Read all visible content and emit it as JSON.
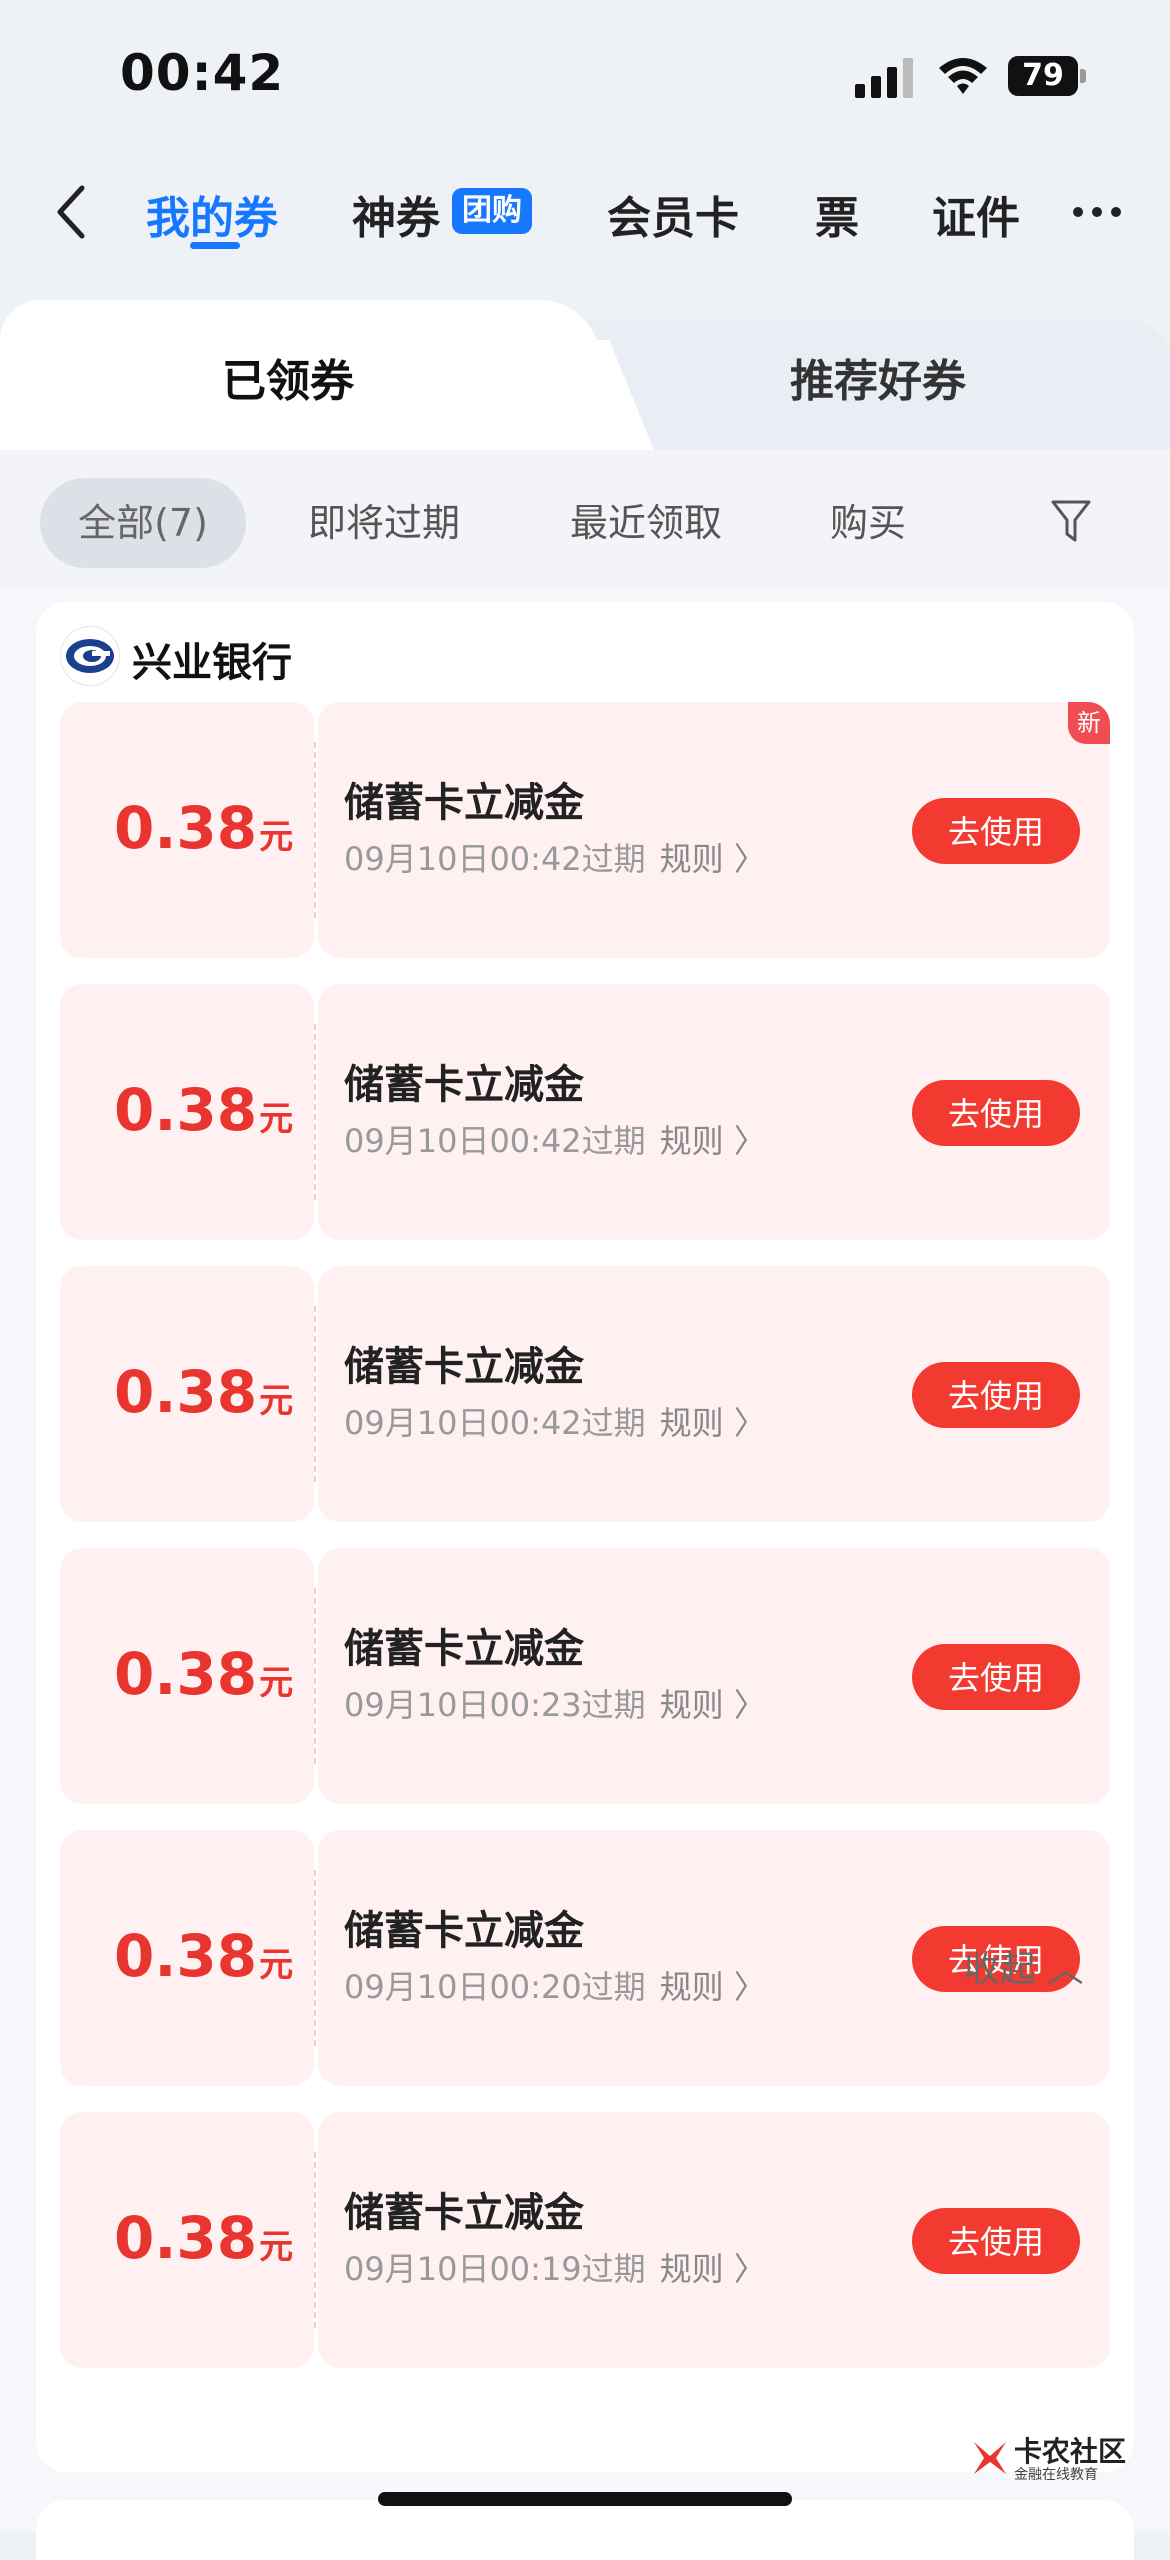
{
  "status": {
    "time": "00:42",
    "battery": "79"
  },
  "nav": {
    "tabs": [
      {
        "label": "我的券"
      },
      {
        "label": "神券"
      },
      {
        "label": "会员卡"
      },
      {
        "label": "票"
      },
      {
        "label": "证件"
      }
    ],
    "badge": "团购"
  },
  "segment": {
    "left": "已领券",
    "right": "推荐好券"
  },
  "filters": [
    "全部(7)",
    "即将过期",
    "最近领取",
    "购买"
  ],
  "bank": {
    "name": "兴业银行"
  },
  "new_badge": "新",
  "coupons": [
    {
      "amount": "0.38",
      "unit": "元",
      "title": "储蓄卡立减金",
      "expire": "09月10日00:42过期",
      "rule": "规则 〉",
      "button": "去使用"
    },
    {
      "amount": "0.38",
      "unit": "元",
      "title": "储蓄卡立减金",
      "expire": "09月10日00:42过期",
      "rule": "规则 〉",
      "button": "去使用"
    },
    {
      "amount": "0.38",
      "unit": "元",
      "title": "储蓄卡立减金",
      "expire": "09月10日00:42过期",
      "rule": "规则 〉",
      "button": "去使用"
    },
    {
      "amount": "0.38",
      "unit": "元",
      "title": "储蓄卡立减金",
      "expire": "09月10日00:23过期",
      "rule": "规则 〉",
      "button": "去使用"
    },
    {
      "amount": "0.38",
      "unit": "元",
      "title": "储蓄卡立减金",
      "expire": "09月10日00:20过期",
      "rule": "规则 〉",
      "button": "去使用"
    },
    {
      "amount": "0.38",
      "unit": "元",
      "title": "储蓄卡立减金",
      "expire": "09月10日00:19过期",
      "rule": "规则 〉",
      "button": "去使用"
    }
  ],
  "collapse_label": "收起 ︿",
  "watermark": {
    "title": "卡农社区",
    "subtitle": "金融在线教育"
  },
  "colors": {
    "accent": "#1677ff",
    "coupon_red": "#f23a30",
    "coupon_bg": "#fff1f1"
  }
}
